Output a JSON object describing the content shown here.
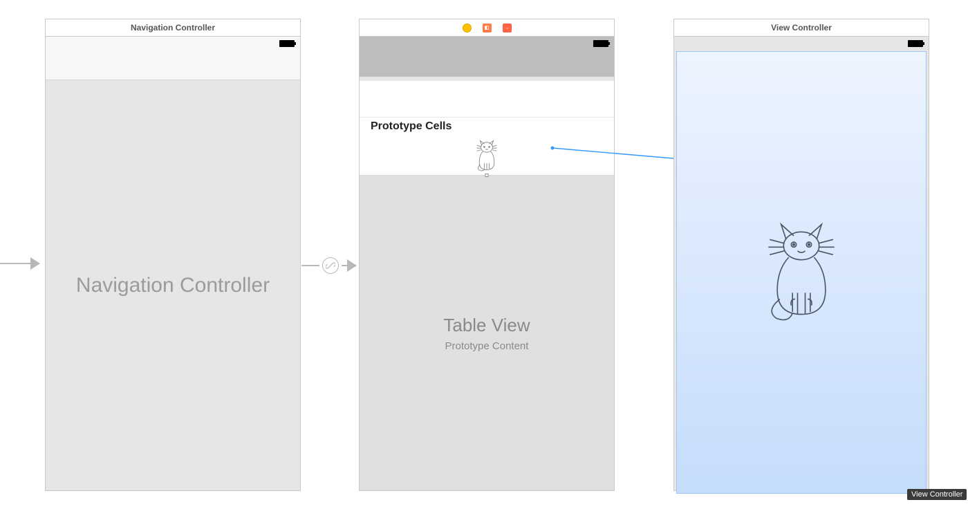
{
  "scenes": {
    "nav_controller": {
      "header_title": "Navigation Controller",
      "body_label": "Navigation Controller"
    },
    "table_controller": {
      "prototype_header": "Prototype Cells",
      "table_title": "Table View",
      "table_subtitle": "Prototype Content"
    },
    "view_controller": {
      "header_title": "View Controller"
    }
  },
  "tooltip": {
    "view_controller": "View Controller"
  }
}
